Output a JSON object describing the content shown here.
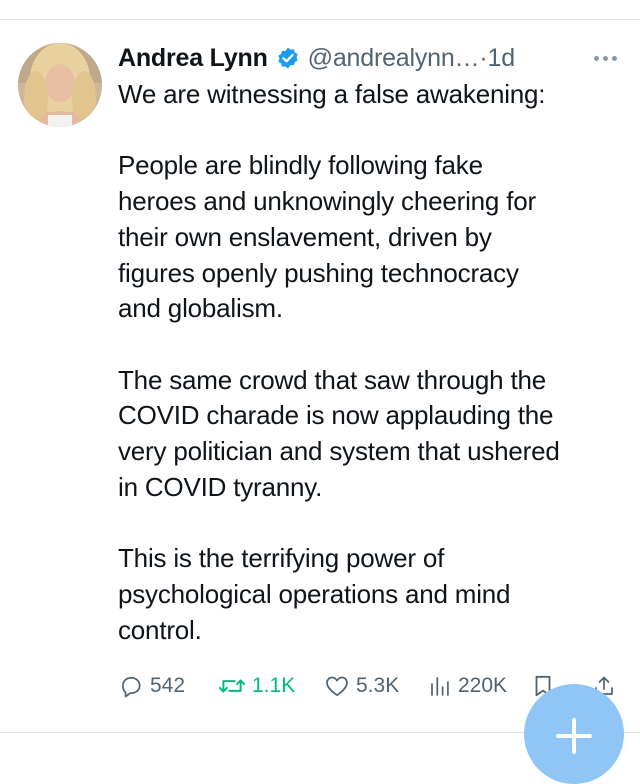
{
  "tweet": {
    "author_name": "Andrea Lynn",
    "handle": "@andrealynn…",
    "separator": " · ",
    "time": "1d",
    "verified": true,
    "accent_color": "#1d9bf0",
    "paragraphs": [
      [
        "We are witnessing a false awakening:"
      ],
      [
        "People are blindly following fake",
        "heroes and unknowingly cheering for",
        "their own enslavement, driven by",
        "figures openly pushing technocracy",
        "and globalism."
      ],
      [
        "The same crowd that saw through the",
        "COVID charade is now applauding the",
        "very politician and system that ushered",
        "in COVID tyranny."
      ],
      [
        "This is the terrifying power of",
        "psychological operations and mind",
        "control."
      ]
    ]
  },
  "actions": {
    "reply": {
      "icon": "reply-icon",
      "count": "542"
    },
    "retweet": {
      "icon": "retweet-icon",
      "count": "1.1K",
      "color": "#00ba7c"
    },
    "like": {
      "icon": "heart-icon",
      "count": "5.3K"
    },
    "views": {
      "icon": "views-icon",
      "count": "220K"
    },
    "bookmark": {
      "icon": "bookmark-icon"
    },
    "share": {
      "icon": "share-icon"
    }
  },
  "fab": {
    "icon": "compose-plus-icon",
    "color": "#8fc6f5"
  }
}
